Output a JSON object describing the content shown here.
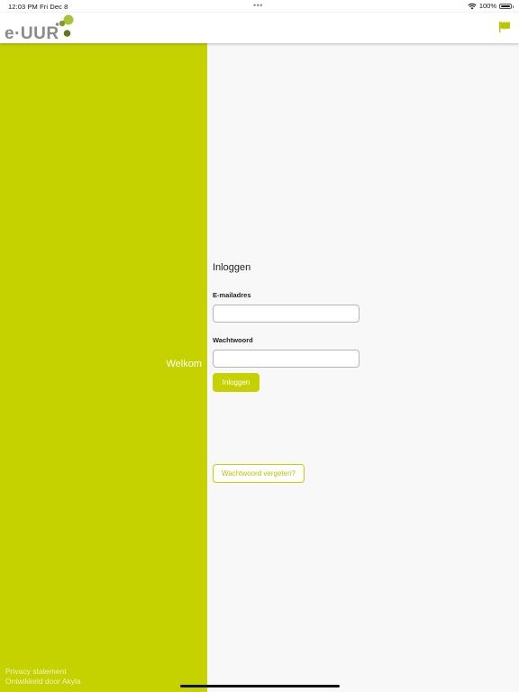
{
  "status_bar": {
    "time_date": "12:03 PM   Fri Dec 8",
    "dots": "•••",
    "battery_label": "100%",
    "wifi_icon": "wifi-icon",
    "battery_icon": "battery-icon"
  },
  "header": {
    "logo_text": "e·UUR",
    "flag_icon": "flag-icon",
    "accent_color": "#c5d200"
  },
  "left_panel": {
    "welcome": "Welkom",
    "privacy_link": "Privacy statement",
    "developed_by": "Ontwikkeld door Akyla"
  },
  "login_form": {
    "title": "Inloggen",
    "email_label": "E-mailadres",
    "email_value": "",
    "password_label": "Wachtwoord",
    "password_value": "",
    "login_button": "Inloggen",
    "forgot_button": "Wachtwoord vergeten?"
  }
}
